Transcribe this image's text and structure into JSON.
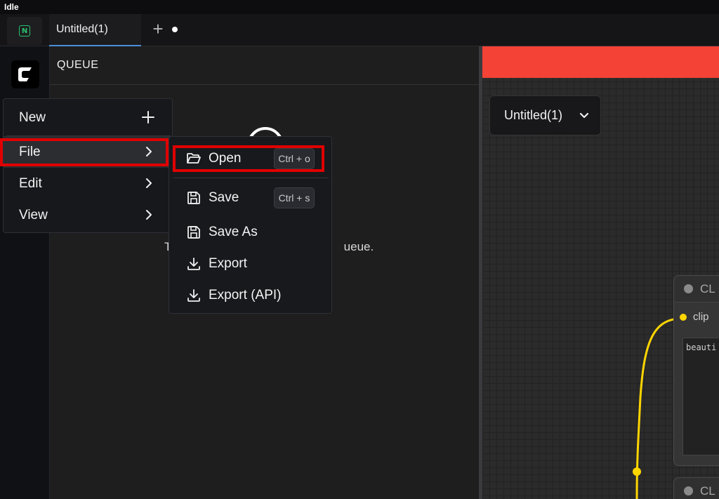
{
  "window": {
    "title": "Idle"
  },
  "tabs": {
    "active_label": "Untitled(1)",
    "add_symbol": "+"
  },
  "queue": {
    "header": "QUEUE",
    "message_visible": "T                                                    ueue."
  },
  "canvas": {
    "workflow_name": "Untitled(1)",
    "banner_color": "#f44336",
    "node1": {
      "title": "CL",
      "port_label": "clip",
      "text": "beauti"
    },
    "node2": {
      "title": "CL"
    }
  },
  "main_menu": {
    "items": [
      {
        "label": "New",
        "icon": "plus-icon"
      },
      {
        "label": "File",
        "icon": "chevron-right-icon"
      },
      {
        "label": "Edit",
        "icon": "chevron-right-icon"
      },
      {
        "label": "View",
        "icon": "chevron-right-icon"
      }
    ]
  },
  "file_submenu": {
    "items": [
      {
        "label": "Open",
        "icon": "folder-open-icon",
        "shortcut": "Ctrl + o"
      },
      {
        "label": "Save",
        "icon": "save-icon",
        "shortcut": "Ctrl + s"
      },
      {
        "label": "Save As",
        "icon": "save-icon"
      },
      {
        "label": "Export",
        "icon": "download-icon"
      },
      {
        "label": "Export (API)",
        "icon": "download-icon"
      }
    ]
  },
  "colors": {
    "highlight": "#e00000",
    "link_yellow": "#ffd500",
    "accent_green": "#27c26c"
  }
}
